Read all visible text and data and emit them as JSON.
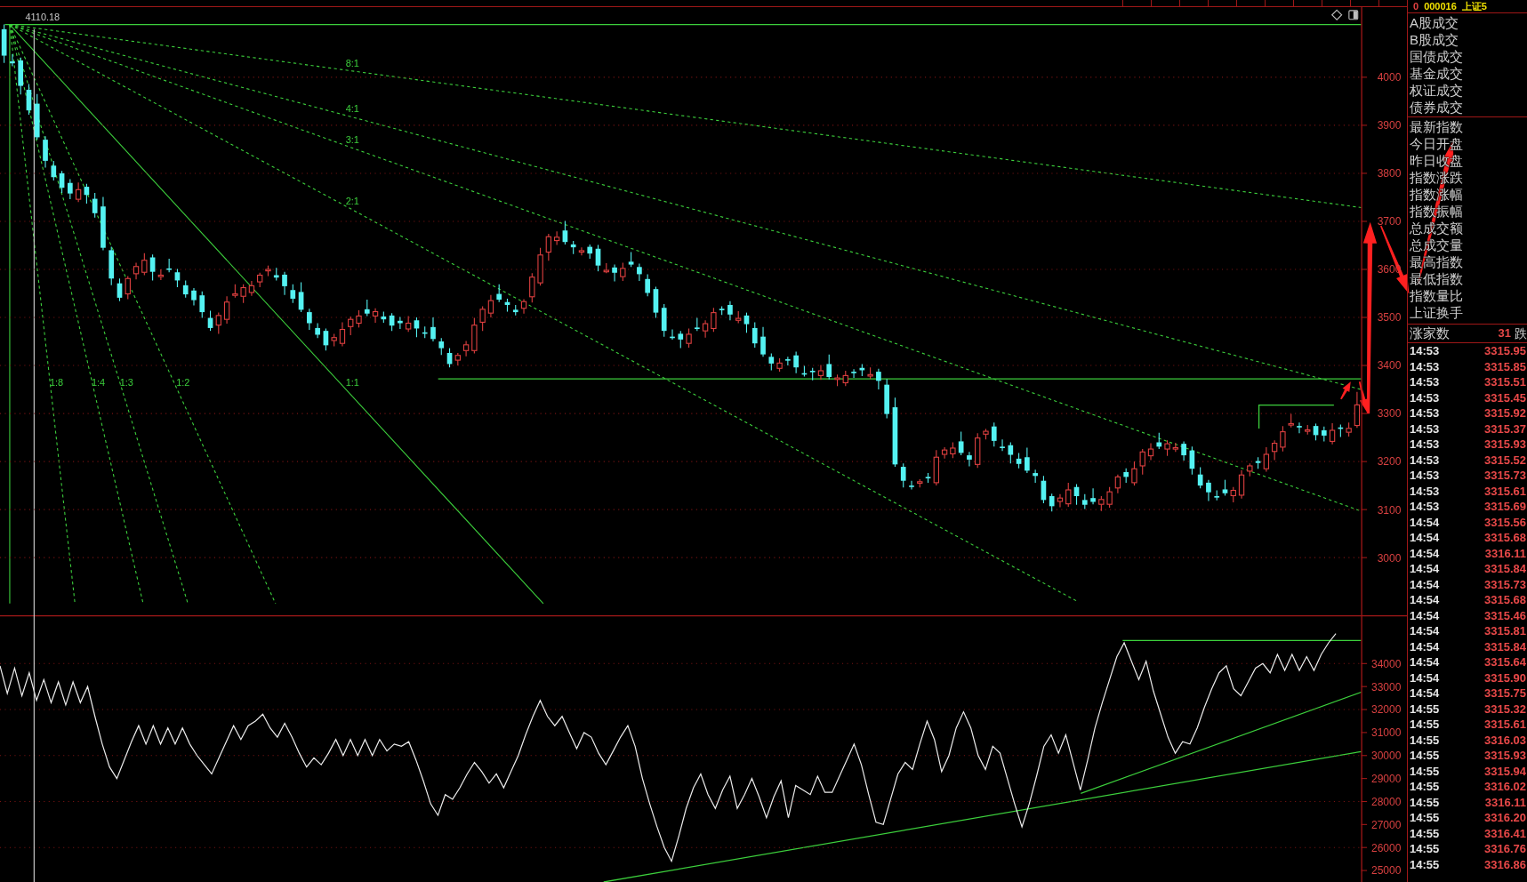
{
  "main_chart": {
    "high_label": "4110.18",
    "gann_fan": [
      {
        "label": "8:1",
        "kind": "dashed"
      },
      {
        "label": "4:1",
        "kind": "dashed"
      },
      {
        "label": "3:1",
        "kind": "dashed"
      },
      {
        "label": "2:1",
        "kind": "dashed"
      },
      {
        "label": "1:8",
        "kind": "dashed"
      },
      {
        "label": "1:4",
        "kind": "dashed"
      },
      {
        "label": "1:3",
        "kind": "dashed"
      },
      {
        "label": "1:2",
        "kind": "dashed"
      },
      {
        "label": "1:1",
        "kind": "solid"
      }
    ],
    "chart_data": {
      "type": "candlestick",
      "grid": true,
      "ylim": [
        2880,
        4146
      ],
      "yticks": [
        4000,
        3900,
        3800,
        3700,
        3600,
        3500,
        3400,
        3300,
        3200,
        3100,
        3000
      ],
      "ohlc": [
        [
          4100,
          4110,
          4030,
          4045
        ],
        [
          4033,
          4048,
          4023,
          4029
        ],
        [
          4035,
          4041,
          3964,
          3982
        ],
        [
          3974,
          3986,
          3922,
          3931
        ],
        [
          3945,
          3965,
          3870,
          3875
        ],
        [
          3870,
          3877,
          3812,
          3826
        ],
        [
          3816,
          3826,
          3785,
          3792
        ],
        [
          3800,
          3805,
          3759,
          3770
        ],
        [
          3780,
          3788,
          3746,
          3758
        ],
        [
          3746,
          3781,
          3740,
          3766
        ],
        [
          3772,
          3778,
          3737,
          3755
        ],
        [
          3747,
          3759,
          3708,
          3717
        ],
        [
          3731,
          3751,
          3640,
          3645
        ],
        [
          3640,
          3647,
          3567,
          3581
        ],
        [
          3571,
          3581,
          3534,
          3541
        ],
        [
          3549,
          3586,
          3538,
          3581
        ],
        [
          3591,
          3614,
          3579,
          3606
        ],
        [
          3594,
          3634,
          3588,
          3619
        ],
        [
          3625,
          3631,
          3577,
          3595
        ],
        [
          3587,
          3600,
          3578,
          3588
        ],
        [
          3602,
          3622,
          3594,
          3599
        ],
        [
          3594,
          3601,
          3563,
          3577
        ],
        [
          3567,
          3577,
          3541,
          3548
        ],
        [
          3556,
          3561,
          3525,
          3536
        ],
        [
          3546,
          3554,
          3499,
          3511
        ],
        [
          3499,
          3514,
          3472,
          3478
        ],
        [
          3484,
          3510,
          3466,
          3504
        ],
        [
          3496,
          3544,
          3487,
          3532
        ],
        [
          3546,
          3569,
          3541,
          3549
        ],
        [
          3544,
          3569,
          3530,
          3562
        ],
        [
          3552,
          3576,
          3545,
          3566
        ],
        [
          3574,
          3593,
          3563,
          3588
        ],
        [
          3598,
          3608,
          3586,
          3600
        ],
        [
          3588,
          3603,
          3577,
          3583
        ],
        [
          3589,
          3595,
          3547,
          3565
        ],
        [
          3557,
          3569,
          3530,
          3539
        ],
        [
          3553,
          3573,
          3511,
          3516
        ],
        [
          3511,
          3518,
          3474,
          3488
        ],
        [
          3478,
          3488,
          3457,
          3464
        ],
        [
          3472,
          3477,
          3431,
          3442
        ],
        [
          3452,
          3466,
          3440,
          3458
        ],
        [
          3446,
          3490,
          3440,
          3475
        ],
        [
          3481,
          3502,
          3463,
          3496
        ],
        [
          3488,
          3515,
          3479,
          3503
        ],
        [
          3517,
          3537,
          3503,
          3508
        ],
        [
          3503,
          3519,
          3489,
          3512
        ],
        [
          3502,
          3512,
          3489,
          3496
        ],
        [
          3504,
          3509,
          3472,
          3483
        ],
        [
          3493,
          3501,
          3476,
          3488
        ],
        [
          3476,
          3503,
          3470,
          3488
        ],
        [
          3494,
          3500,
          3459,
          3477
        ],
        [
          3469,
          3481,
          3457,
          3466
        ],
        [
          3480,
          3500,
          3450,
          3455
        ],
        [
          3450,
          3457,
          3422,
          3436
        ],
        [
          3426,
          3436,
          3396,
          3403
        ],
        [
          3411,
          3426,
          3400,
          3421
        ],
        [
          3431,
          3451,
          3419,
          3443
        ],
        [
          3431,
          3499,
          3425,
          3484
        ],
        [
          3490,
          3523,
          3472,
          3517
        ],
        [
          3509,
          3547,
          3500,
          3535
        ],
        [
          3549,
          3569,
          3532,
          3537
        ],
        [
          3532,
          3539,
          3512,
          3526
        ],
        [
          3516,
          3526,
          3504,
          3511
        ],
        [
          3519,
          3538,
          3508,
          3533
        ],
        [
          3543,
          3592,
          3531,
          3584
        ],
        [
          3572,
          3645,
          3566,
          3630
        ],
        [
          3636,
          3674,
          3618,
          3668
        ],
        [
          3660,
          3679,
          3651,
          3667
        ],
        [
          3681,
          3701,
          3652,
          3657
        ],
        [
          3652,
          3659,
          3632,
          3646
        ],
        [
          3636,
          3646,
          3629,
          3639
        ],
        [
          3647,
          3652,
          3622,
          3633
        ],
        [
          3643,
          3651,
          3596,
          3608
        ],
        [
          3596,
          3613,
          3592,
          3598
        ],
        [
          3604,
          3610,
          3575,
          3593
        ],
        [
          3585,
          3614,
          3576,
          3602
        ],
        [
          3616,
          3636,
          3605,
          3610
        ],
        [
          3605,
          3612,
          3576,
          3590
        ],
        [
          3580,
          3590,
          3544,
          3551
        ],
        [
          3559,
          3564,
          3499,
          3510
        ],
        [
          3520,
          3528,
          3460,
          3472
        ],
        [
          3460,
          3475,
          3454,
          3460
        ],
        [
          3466,
          3472,
          3436,
          3454
        ],
        [
          3446,
          3477,
          3437,
          3465
        ],
        [
          3479,
          3499,
          3472,
          3477
        ],
        [
          3472,
          3494,
          3458,
          3487
        ],
        [
          3477,
          3520,
          3470,
          3510
        ],
        [
          3518,
          3523,
          3505,
          3516
        ],
        [
          3526,
          3534,
          3494,
          3506
        ],
        [
          3494,
          3513,
          3488,
          3498
        ],
        [
          3504,
          3510,
          3468,
          3486
        ],
        [
          3478,
          3490,
          3437,
          3446
        ],
        [
          3460,
          3480,
          3418,
          3423
        ],
        [
          3418,
          3425,
          3390,
          3404
        ],
        [
          3394,
          3415,
          3387,
          3405
        ],
        [
          3413,
          3418,
          3400,
          3411
        ],
        [
          3421,
          3429,
          3384,
          3396
        ],
        [
          3384,
          3399,
          3377,
          3383
        ],
        [
          3389,
          3395,
          3369,
          3387
        ],
        [
          3379,
          3401,
          3370,
          3389
        ],
        [
          3403,
          3423,
          3371,
          3376
        ],
        [
          3371,
          3381,
          3357,
          3374
        ],
        [
          3364,
          3389,
          3357,
          3379
        ],
        [
          3387,
          3392,
          3374,
          3385
        ],
        [
          3395,
          3403,
          3378,
          3390
        ],
        [
          3378,
          3396,
          3372,
          3381
        ],
        [
          3387,
          3393,
          3350,
          3368
        ],
        [
          3360,
          3372,
          3290,
          3299
        ],
        [
          3313,
          3333,
          3189,
          3194
        ],
        [
          3189,
          3196,
          3146,
          3160
        ],
        [
          3150,
          3160,
          3142,
          3149
        ],
        [
          3157,
          3163,
          3146,
          3158
        ],
        [
          3168,
          3176,
          3156,
          3168
        ],
        [
          3156,
          3224,
          3150,
          3209
        ],
        [
          3215,
          3230,
          3206,
          3224
        ],
        [
          3216,
          3240,
          3207,
          3228
        ],
        [
          3242,
          3262,
          3213,
          3218
        ],
        [
          3213,
          3220,
          3190,
          3204
        ],
        [
          3194,
          3259,
          3187,
          3249
        ],
        [
          3257,
          3268,
          3246,
          3263
        ],
        [
          3273,
          3281,
          3231,
          3243
        ],
        [
          3231,
          3246,
          3222,
          3228
        ],
        [
          3234,
          3240,
          3196,
          3214
        ],
        [
          3206,
          3218,
          3186,
          3195
        ],
        [
          3209,
          3229,
          3176,
          3181
        ],
        [
          3176,
          3183,
          3156,
          3170
        ],
        [
          3160,
          3170,
          3113,
          3120
        ],
        [
          3128,
          3133,
          3096,
          3107
        ],
        [
          3117,
          3132,
          3105,
          3124
        ],
        [
          3112,
          3156,
          3106,
          3141
        ],
        [
          3147,
          3153,
          3110,
          3128
        ],
        [
          3120,
          3132,
          3101,
          3110
        ],
        [
          3124,
          3144,
          3111,
          3116
        ],
        [
          3111,
          3128,
          3097,
          3121
        ],
        [
          3111,
          3147,
          3104,
          3137
        ],
        [
          3145,
          3173,
          3134,
          3168
        ],
        [
          3178,
          3186,
          3156,
          3168
        ],
        [
          3156,
          3200,
          3150,
          3185
        ],
        [
          3191,
          3226,
          3173,
          3220
        ],
        [
          3212,
          3238,
          3203,
          3226
        ],
        [
          3240,
          3260,
          3226,
          3231
        ],
        [
          3226,
          3244,
          3212,
          3237
        ],
        [
          3227,
          3239,
          3220,
          3229
        ],
        [
          3237,
          3242,
          3202,
          3213
        ],
        [
          3223,
          3231,
          3173,
          3185
        ],
        [
          3173,
          3188,
          3144,
          3150
        ],
        [
          3156,
          3162,
          3118,
          3136
        ],
        [
          3128,
          3140,
          3119,
          3128
        ],
        [
          3142,
          3162,
          3129,
          3134
        ],
        [
          3129,
          3147,
          3115,
          3140
        ],
        [
          3130,
          3182,
          3123,
          3172
        ],
        [
          3180,
          3196,
          3169,
          3191
        ],
        [
          3201,
          3209,
          3185,
          3197
        ],
        [
          3185,
          3230,
          3179,
          3215
        ],
        [
          3221,
          3244,
          3203,
          3238
        ],
        [
          3230,
          3274,
          3221,
          3262
        ],
        [
          3276,
          3299,
          3271,
          3279
        ],
        [
          3274,
          3281,
          3259,
          3273
        ],
        [
          3263,
          3276,
          3256,
          3266
        ],
        [
          3274,
          3279,
          3244,
          3255
        ],
        [
          3265,
          3273,
          3242,
          3254
        ],
        [
          3242,
          3280,
          3236,
          3265
        ],
        [
          3271,
          3277,
          3251,
          3269
        ],
        [
          3261,
          3281,
          3252,
          3269
        ],
        [
          3275,
          3345,
          3270,
          3318
        ]
      ]
    }
  },
  "indicator_chart": {
    "chart_data": {
      "type": "line",
      "grid": true,
      "ylim": [
        24500,
        36100
      ],
      "yticks": [
        34000,
        33000,
        32000,
        31000,
        30000,
        29000,
        28000,
        27000,
        26000,
        25000
      ],
      "values": [
        33900,
        32700,
        33800,
        32600,
        33600,
        32400,
        33300,
        32300,
        33200,
        32200,
        33200,
        32300,
        33000,
        31700,
        30500,
        29500,
        29000,
        29800,
        30600,
        31300,
        30500,
        31300,
        30500,
        31200,
        30500,
        31200,
        30500,
        30000,
        29600,
        29200,
        29900,
        30600,
        31300,
        30700,
        31300,
        31500,
        31800,
        31200,
        30800,
        31400,
        30800,
        30100,
        29500,
        29900,
        29600,
        30100,
        30700,
        30000,
        30700,
        30000,
        30700,
        30000,
        30700,
        30200,
        30500,
        30400,
        30600,
        29800,
        28900,
        27900,
        27400,
        28300,
        28100,
        28600,
        29200,
        29700,
        29300,
        28800,
        29200,
        28600,
        29300,
        30000,
        30900,
        31700,
        32400,
        31700,
        31300,
        31700,
        31000,
        30300,
        31000,
        30800,
        30100,
        29600,
        30200,
        30800,
        31300,
        30400,
        29000,
        27900,
        26900,
        26000,
        25400,
        26500,
        27700,
        28600,
        29200,
        28300,
        27700,
        28500,
        29100,
        27700,
        28300,
        29000,
        28200,
        27300,
        28200,
        28900,
        27300,
        28700,
        28500,
        28300,
        29100,
        28400,
        28400,
        29100,
        29800,
        30500,
        29600,
        28300,
        27100,
        27000,
        28100,
        29200,
        29700,
        29400,
        30500,
        31500,
        30700,
        29300,
        30000,
        31200,
        31900,
        31200,
        30000,
        29400,
        30400,
        30100,
        29000,
        27900,
        26900,
        27900,
        29100,
        30400,
        30900,
        30100,
        30900,
        29700,
        28500,
        29800,
        31200,
        32300,
        33300,
        34300,
        34900,
        34100,
        33300,
        34100,
        32800,
        31800,
        30800,
        30100,
        30600,
        30500,
        31200,
        32100,
        32900,
        33600,
        33900,
        32900,
        32600,
        33200,
        33800,
        34000,
        33600,
        34400,
        33700,
        34400,
        33700,
        34300,
        33700,
        34400,
        34900,
        35300
      ]
    }
  },
  "quote_panel": {
    "header": {
      "sign": "0",
      "code": "000016",
      "name": "上证5"
    },
    "trade_labels": [
      "A股成交",
      "B股成交",
      "国债成交",
      "基金成交",
      "权证成交",
      "债券成交"
    ],
    "index_labels": [
      "最新指数",
      "今日开盘",
      "昨日收盘",
      "指数涨跌",
      "指数涨幅",
      "指数振幅",
      "总成交额",
      "总成交量",
      "最高指数",
      "最低指数",
      "指数量比",
      "上证换手"
    ],
    "breadth": {
      "label": "涨家数",
      "value": "31",
      "next_label": "跌"
    },
    "ticks": [
      {
        "time": "14:53",
        "price": "3315.95"
      },
      {
        "time": "14:53",
        "price": "3315.85"
      },
      {
        "time": "14:53",
        "price": "3315.51"
      },
      {
        "time": "14:53",
        "price": "3315.45"
      },
      {
        "time": "14:53",
        "price": "3315.92"
      },
      {
        "time": "14:53",
        "price": "3315.37"
      },
      {
        "time": "14:53",
        "price": "3315.93"
      },
      {
        "time": "14:53",
        "price": "3315.52"
      },
      {
        "time": "14:53",
        "price": "3315.73"
      },
      {
        "time": "14:53",
        "price": "3315.61"
      },
      {
        "time": "14:53",
        "price": "3315.69"
      },
      {
        "time": "14:54",
        "price": "3315.56"
      },
      {
        "time": "14:54",
        "price": "3315.68"
      },
      {
        "time": "14:54",
        "price": "3316.11"
      },
      {
        "time": "14:54",
        "price": "3315.84"
      },
      {
        "time": "14:54",
        "price": "3315.73"
      },
      {
        "time": "14:54",
        "price": "3315.68"
      },
      {
        "time": "14:54",
        "price": "3315.46"
      },
      {
        "time": "14:54",
        "price": "3315.81"
      },
      {
        "time": "14:54",
        "price": "3315.84"
      },
      {
        "time": "14:54",
        "price": "3315.64"
      },
      {
        "time": "14:54",
        "price": "3315.90"
      },
      {
        "time": "14:54",
        "price": "3315.75"
      },
      {
        "time": "14:55",
        "price": "3315.32"
      },
      {
        "time": "14:55",
        "price": "3315.61"
      },
      {
        "time": "14:55",
        "price": "3316.03"
      },
      {
        "time": "14:55",
        "price": "3315.93"
      },
      {
        "time": "14:55",
        "price": "3315.94"
      },
      {
        "time": "14:55",
        "price": "3316.02"
      },
      {
        "time": "14:55",
        "price": "3316.11"
      },
      {
        "time": "14:55",
        "price": "3316.20"
      },
      {
        "time": "14:55",
        "price": "3316.41"
      },
      {
        "time": "14:55",
        "price": "3316.76"
      },
      {
        "time": "14:55",
        "price": "3316.86"
      }
    ]
  }
}
